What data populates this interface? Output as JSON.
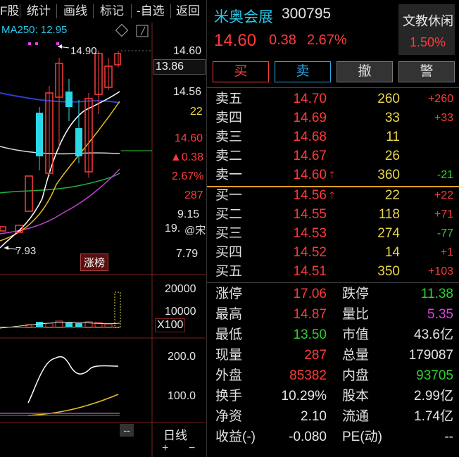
{
  "toolbar": {
    "items": [
      "F股",
      "统计",
      "画线",
      "标记",
      "-自选",
      "返回"
    ]
  },
  "chart": {
    "ma_label": "MA250: 12.95",
    "high_marker": "14.90",
    "low_marker": "7.93",
    "price_ticks": [
      "14.60",
      "14.56",
      "22",
      "14.60",
      "▲0.38",
      "2.67%",
      "287",
      "9.15",
      "19.",
      "7.79"
    ],
    "crosshair_price": "13.86",
    "badge": "涨榜",
    "vol_ticks": [
      "20000",
      "10000"
    ],
    "vol_unit": "X100",
    "ind_ticks": [
      "200.0",
      "100.0"
    ],
    "period": "日线",
    "dash": "--",
    "plus": "+",
    "minus": "−",
    "watermark": "@宋嘉红观势"
  },
  "stock": {
    "name": "米奥会展",
    "code": "300795",
    "price": "14.60",
    "change": "0.38",
    "change_pct": "2.67%",
    "sector": "文教休闲",
    "sector_pct": "1.50%"
  },
  "buttons": {
    "buy": "买",
    "sell": "卖",
    "cancel": "撤",
    "alert": "警"
  },
  "asks": [
    {
      "label": "卖五",
      "price": "14.70",
      "vol": "260",
      "chg": "+260",
      "arrow": ""
    },
    {
      "label": "卖四",
      "price": "14.69",
      "vol": "33",
      "chg": "+33",
      "arrow": ""
    },
    {
      "label": "卖三",
      "price": "14.68",
      "vol": "11",
      "chg": "",
      "arrow": ""
    },
    {
      "label": "卖二",
      "price": "14.67",
      "vol": "26",
      "chg": "",
      "arrow": ""
    },
    {
      "label": "卖一",
      "price": "14.60",
      "vol": "360",
      "chg": "-21",
      "arrow": "🡑"
    }
  ],
  "bids": [
    {
      "label": "买一",
      "price": "14.56",
      "vol": "22",
      "chg": "+22",
      "arrow": "🡑"
    },
    {
      "label": "买二",
      "price": "14.55",
      "vol": "118",
      "chg": "+71",
      "arrow": ""
    },
    {
      "label": "买三",
      "price": "14.53",
      "vol": "274",
      "chg": "-77",
      "arrow": ""
    },
    {
      "label": "买四",
      "price": "14.52",
      "vol": "14",
      "chg": "+1",
      "arrow": ""
    },
    {
      "label": "买五",
      "price": "14.51",
      "vol": "350",
      "chg": "+103",
      "arrow": ""
    }
  ],
  "stats": [
    {
      "l1": "涨停",
      "v1": "17.06",
      "c1": "red",
      "l2": "跌停",
      "v2": "11.38",
      "c2": "green"
    },
    {
      "l1": "最高",
      "v1": "14.87",
      "c1": "red",
      "l2": "量比",
      "v2": "5.35",
      "c2": "magenta"
    },
    {
      "l1": "最低",
      "v1": "13.50",
      "c1": "green",
      "l2": "市值",
      "v2": "43.6亿",
      "c2": "white"
    },
    {
      "l1": "现量",
      "v1": "287",
      "c1": "red",
      "l2": "总量",
      "v2": "179087",
      "c2": "white"
    },
    {
      "l1": "外盘",
      "v1": "85382",
      "c1": "red",
      "l2": "内盘",
      "v2": "93705",
      "c2": "green"
    },
    {
      "l1": "换手",
      "v1": "10.29%",
      "c1": "white",
      "l2": "股本",
      "v2": "2.99亿",
      "c2": "white"
    },
    {
      "l1": "净资",
      "v1": "2.10",
      "c1": "white",
      "l2": "流通",
      "v2": "1.74亿",
      "c2": "white"
    },
    {
      "l1": "收益(-)",
      "v1": "-0.080",
      "c1": "white",
      "l2": "PE(动)",
      "v2": "--",
      "c2": "white"
    }
  ],
  "colors": {
    "up": "#ff3b3b",
    "down": "#2fd02f",
    "volume": "#e8d64a",
    "accent": "#28c8e8"
  }
}
